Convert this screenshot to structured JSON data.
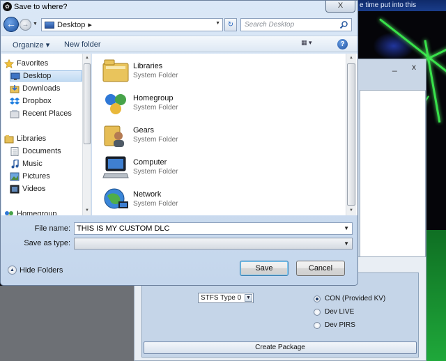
{
  "background": {
    "top_strip_text": "e time put into this",
    "stfs_value": "STFS Type 0",
    "radios": [
      {
        "label": "CON (Provided KV)",
        "checked": true
      },
      {
        "label": "Dev LIVE",
        "checked": false
      },
      {
        "label": "Dev PIRS",
        "checked": false
      }
    ],
    "create_button": "Create Package",
    "window_minimize": "_",
    "window_close": "x"
  },
  "dialog": {
    "title": "Save to where?",
    "close_label": "X",
    "address": {
      "location": "Desktop",
      "separator": "▸"
    },
    "search": {
      "placeholder": "Search Desktop"
    },
    "toolbar": {
      "organize": "Organize ▾",
      "new_folder": "New folder",
      "help": "?"
    },
    "nav": [
      {
        "label": "Favorites",
        "icon": "star-icon",
        "indent": 0,
        "selected": false
      },
      {
        "label": "Desktop",
        "icon": "desktop-icon",
        "indent": 1,
        "selected": true
      },
      {
        "label": "Downloads",
        "icon": "downloads-icon",
        "indent": 1,
        "selected": false
      },
      {
        "label": "Dropbox",
        "icon": "dropbox-icon",
        "indent": 1,
        "selected": false
      },
      {
        "label": "Recent Places",
        "icon": "recent-places-icon",
        "indent": 1,
        "selected": false
      },
      {
        "label": "Libraries",
        "icon": "libraries-icon",
        "indent": 0,
        "selected": false
      },
      {
        "label": "Documents",
        "icon": "documents-icon",
        "indent": 1,
        "selected": false
      },
      {
        "label": "Music",
        "icon": "music-icon",
        "indent": 1,
        "selected": false
      },
      {
        "label": "Pictures",
        "icon": "pictures-icon",
        "indent": 1,
        "selected": false
      },
      {
        "label": "Videos",
        "icon": "videos-icon",
        "indent": 1,
        "selected": false
      },
      {
        "label": "Homegroup",
        "icon": "homegroup-icon",
        "indent": 0,
        "selected": false
      }
    ],
    "items": [
      {
        "name": "Libraries",
        "type": "System Folder",
        "icon": "libraries-folder-icon"
      },
      {
        "name": "Homegroup",
        "type": "System Folder",
        "icon": "homegroup-folder-icon"
      },
      {
        "name": "Gears",
        "type": "System Folder",
        "icon": "user-folder-icon"
      },
      {
        "name": "Computer",
        "type": "System Folder",
        "icon": "computer-icon"
      },
      {
        "name": "Network",
        "type": "System Folder",
        "icon": "network-icon"
      }
    ],
    "file_name_label": "File name:",
    "file_name_value": "THIS IS MY CUSTOM DLC",
    "save_type_label": "Save as type:",
    "save_type_value": "",
    "hide_folders": "Hide Folders",
    "save_button": "Save",
    "cancel_button": "Cancel"
  },
  "colors": {
    "accent": "#1d4f9e",
    "laser_green": "#38e24a",
    "selection": "#c2dcf3"
  }
}
